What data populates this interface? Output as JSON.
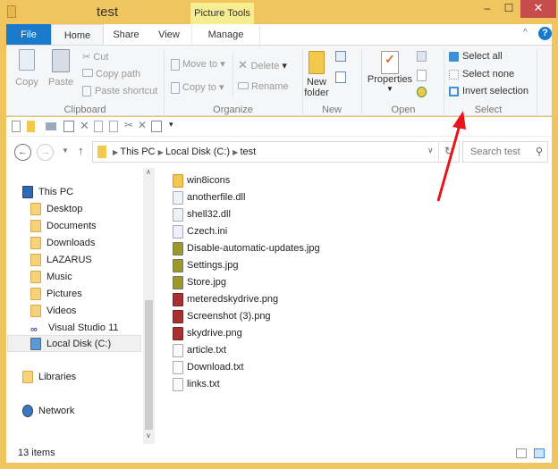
{
  "window": {
    "title": "test",
    "context_tab": "Picture Tools",
    "minimize": "‒",
    "maximize": "☐",
    "close": "✕"
  },
  "tabs": [
    "File",
    "Home",
    "Share",
    "View",
    "Manage"
  ],
  "ribbon": {
    "clipboard": {
      "label": "Clipboard",
      "copy": "Copy",
      "paste": "Paste",
      "cut": "Cut",
      "copy_path": "Copy path",
      "paste_shortcut": "Paste shortcut"
    },
    "organize": {
      "label": "Organize",
      "move_to": "Move to",
      "copy_to": "Copy to",
      "delete": "Delete",
      "rename": "Rename"
    },
    "new": {
      "label": "New",
      "new_folder": "New folder"
    },
    "open": {
      "label": "Open",
      "properties": "Properties"
    },
    "select": {
      "label": "Select",
      "select_all": "Select all",
      "select_none": "Select none",
      "invert": "Invert selection"
    }
  },
  "address": {
    "crumbs": [
      "This PC",
      "Local Disk (C:)",
      "test"
    ],
    "search_placeholder": "Search test"
  },
  "nav": {
    "this_pc": "This PC",
    "items": [
      "Desktop",
      "Documents",
      "Downloads",
      "LAZARUS",
      "Music",
      "Pictures",
      "Videos",
      "Visual Studio 11",
      "Local Disk (C:)"
    ],
    "libraries": "Libraries",
    "network": "Network"
  },
  "files": [
    {
      "name": "win8icons",
      "type": "folder"
    },
    {
      "name": "anotherfile.dll",
      "type": "dll"
    },
    {
      "name": "shell32.dll",
      "type": "dll"
    },
    {
      "name": "Czech.ini",
      "type": "ini"
    },
    {
      "name": "Disable-automatic-updates.jpg",
      "type": "jpg"
    },
    {
      "name": "Settings.jpg",
      "type": "jpg"
    },
    {
      "name": "Store.jpg",
      "type": "jpg"
    },
    {
      "name": "meteredskydrive.png",
      "type": "png"
    },
    {
      "name": "Screenshot (3).png",
      "type": "png"
    },
    {
      "name": "skydrive.png",
      "type": "png"
    },
    {
      "name": "article.txt",
      "type": "txt"
    },
    {
      "name": "Download.txt",
      "type": "txt"
    },
    {
      "name": "links.txt",
      "type": "txt"
    }
  ],
  "status": {
    "count": "13 items"
  },
  "colors": {
    "frame": "#f0c45f",
    "file_tab": "#1979ca",
    "context": "#f5ed90",
    "arrow": "#e8141b"
  }
}
